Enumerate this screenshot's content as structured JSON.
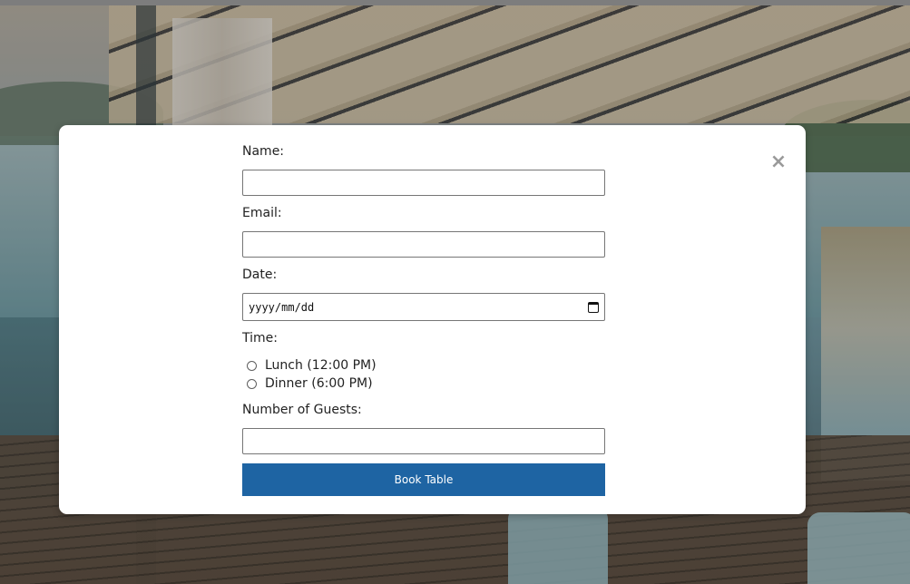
{
  "form": {
    "name_label": "Name:",
    "name_value": "",
    "email_label": "Email:",
    "email_value": "",
    "date_label": "Date:",
    "date_placeholder": "yyyy/mm/dd",
    "time_label": "Time:",
    "time_options": [
      {
        "label": "Lunch (12:00 PM)",
        "selected": false
      },
      {
        "label": "Dinner (6:00 PM)",
        "selected": false
      }
    ],
    "guests_label": "Number of Guests:",
    "guests_value": "",
    "submit_label": "Book Table"
  },
  "modal": {
    "close_glyph": "×"
  },
  "icons": {
    "close": "close-icon",
    "calendar": "calendar-icon"
  },
  "colors": {
    "button_bg": "#1e64a3",
    "button_text": "#ffffff",
    "close_icon": "#9a9a9a"
  }
}
